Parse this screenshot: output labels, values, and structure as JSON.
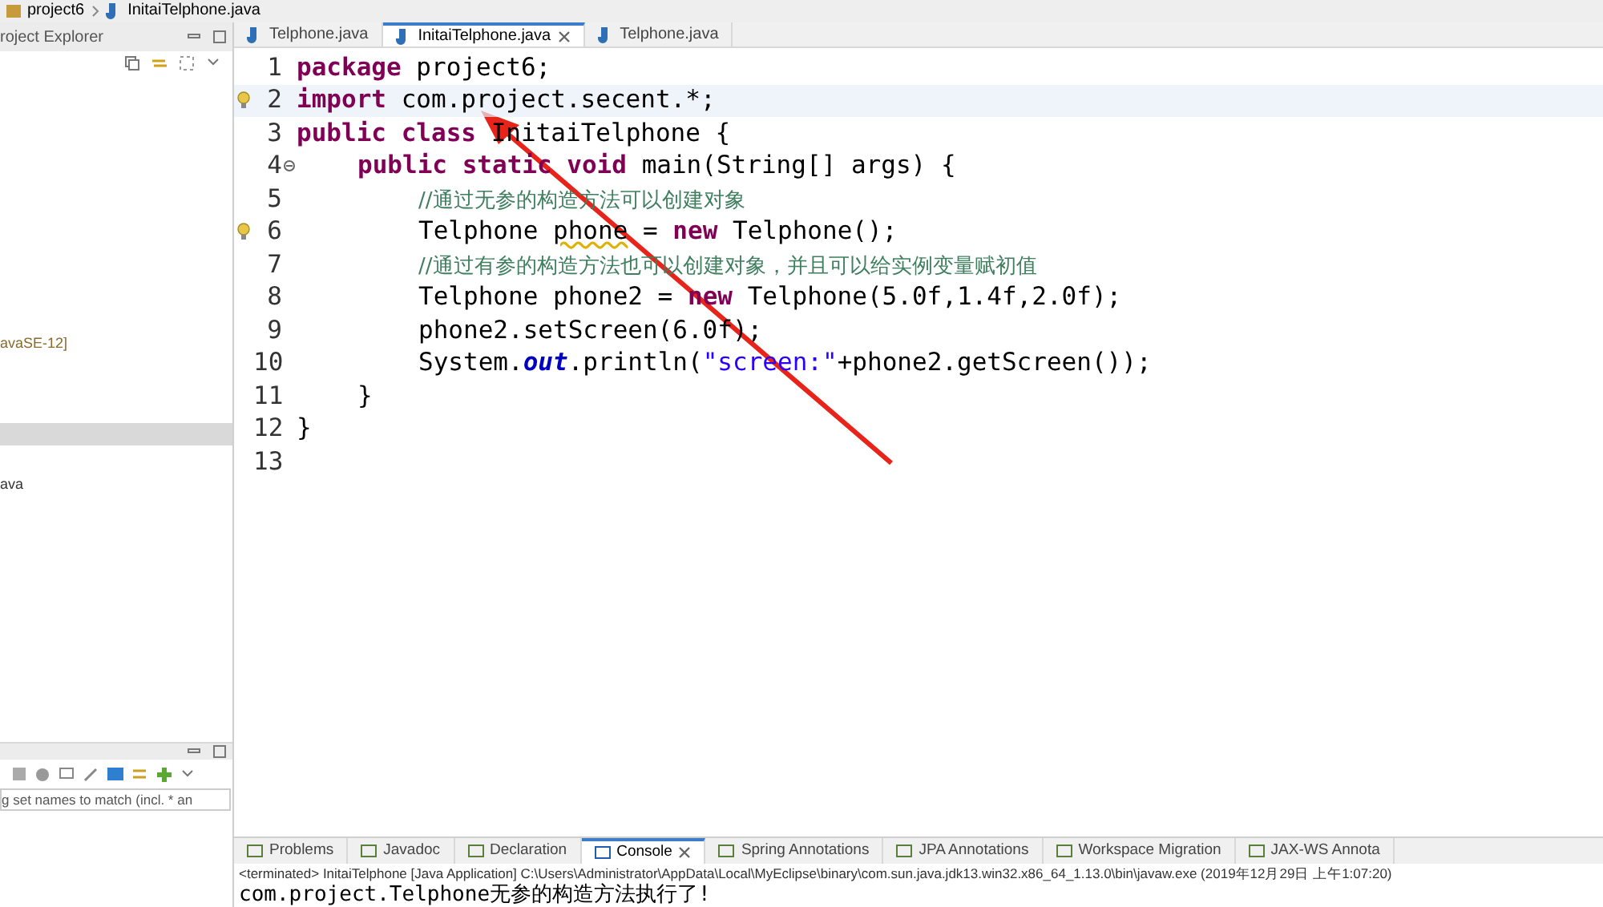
{
  "breadcrumb": [
    "project6",
    "InitaiTelphone.java"
  ],
  "explorer": {
    "title": "roject Explorer",
    "tree_items": [
      "avaSE-12]"
    ],
    "outline_items": [
      "ava"
    ]
  },
  "filter": {
    "placeholder": "g set names to match (incl. * an"
  },
  "editor_tabs": [
    {
      "label": "Telphone.java",
      "selected": false,
      "closable": false
    },
    {
      "label": "InitaiTelphone.java",
      "selected": true,
      "closable": true
    },
    {
      "label": "Telphone.java",
      "selected": false,
      "closable": false
    }
  ],
  "code_lines": [
    {
      "number": "1",
      "kind": "top",
      "current": false,
      "bulb": false,
      "fold": false,
      "tokens": [
        {
          "kind": "keyword",
          "text": "package "
        },
        {
          "kind": "plain",
          "text": "project6;"
        }
      ]
    },
    {
      "number": "2",
      "kind": "top",
      "current": true,
      "bulb": true,
      "fold": false,
      "tokens": [
        {
          "kind": "keyword",
          "text": "import "
        },
        {
          "kind": "plain",
          "text": "com.project.secent.*;"
        }
      ]
    },
    {
      "number": "3",
      "kind": "top",
      "current": false,
      "bulb": false,
      "fold": false,
      "tokens": [
        {
          "kind": "keyword",
          "text": "public class "
        },
        {
          "kind": "plain",
          "text": "InitaiTelphone {"
        }
      ]
    },
    {
      "number": "4",
      "kind": "member",
      "current": false,
      "bulb": false,
      "fold": true,
      "tokens": [
        {
          "kind": "keyword",
          "text": "public static void "
        },
        {
          "kind": "plain",
          "text": "main(String[] args) {"
        }
      ]
    },
    {
      "number": "5",
      "kind": "body",
      "current": false,
      "bulb": false,
      "fold": false,
      "tokens": [
        {
          "kind": "comment",
          "text": "//通过无参的构造方法可以创建对象"
        }
      ]
    },
    {
      "number": "6",
      "kind": "body",
      "current": false,
      "bulb": true,
      "fold": false,
      "tokens": [
        {
          "kind": "plain",
          "text": "Telphone "
        },
        {
          "kind": "warning",
          "text": "phone"
        },
        {
          "kind": "plain",
          "text": " = "
        },
        {
          "kind": "keyword",
          "text": "new "
        },
        {
          "kind": "plain",
          "text": "Telphone();"
        }
      ]
    },
    {
      "number": "7",
      "kind": "body",
      "current": false,
      "bulb": false,
      "fold": false,
      "tokens": [
        {
          "kind": "comment",
          "text": "//通过有参的构造方法也可以创建对象，并且可以给实例变量赋初值"
        }
      ]
    },
    {
      "number": "8",
      "kind": "body",
      "current": false,
      "bulb": false,
      "fold": false,
      "tokens": [
        {
          "kind": "plain",
          "text": "Telphone phone2 = "
        },
        {
          "kind": "keyword",
          "text": "new "
        },
        {
          "kind": "plain",
          "text": "Telphone(5.0f,1.4f,2.0f);"
        }
      ]
    },
    {
      "number": "9",
      "kind": "body",
      "current": false,
      "bulb": false,
      "fold": false,
      "tokens": [
        {
          "kind": "plain",
          "text": "phone2.setScreen(6.0f);"
        }
      ]
    },
    {
      "number": "10",
      "kind": "body",
      "current": false,
      "bulb": false,
      "fold": false,
      "tokens": [
        {
          "kind": "plain",
          "text": "System."
        },
        {
          "kind": "field",
          "text": "out"
        },
        {
          "kind": "plain",
          "text": ".println("
        },
        {
          "kind": "string",
          "text": "\"screen:\""
        },
        {
          "kind": "plain",
          "text": "+phone2.getScreen());"
        }
      ]
    },
    {
      "number": "11",
      "kind": "member",
      "current": false,
      "bulb": false,
      "fold": false,
      "tokens": [
        {
          "kind": "plain",
          "text": "}"
        }
      ]
    },
    {
      "number": "12",
      "kind": "top",
      "current": false,
      "bulb": false,
      "fold": false,
      "tokens": [
        {
          "kind": "plain",
          "text": "}"
        }
      ]
    },
    {
      "number": "13",
      "current": false,
      "bulb": false,
      "fold": false
    }
  ],
  "console_tabs": [
    {
      "label": "Problems",
      "selected": false,
      "closable": false
    },
    {
      "label": "Javadoc",
      "selected": false,
      "closable": false
    },
    {
      "label": "Declaration",
      "selected": false,
      "closable": false
    },
    {
      "label": "Console",
      "selected": true,
      "closable": true
    },
    {
      "label": "Spring Annotations",
      "selected": false,
      "closable": false
    },
    {
      "label": "JPA Annotations",
      "selected": false,
      "closable": false
    },
    {
      "label": "Workspace Migration",
      "selected": false,
      "closable": false
    },
    {
      "label": "JAX-WS Annota",
      "selected": false,
      "closable": false
    }
  ],
  "console_status": "<terminated> InitaiTelphone [Java Application] C:\\Users\\Administrator\\AppData\\Local\\MyEclipse\\binary\\com.sun.java.jdk13.win32.x86_64_1.13.0\\bin\\javaw.exe (2019年12月29日 上午1:07:20)",
  "console_output": "com.project.Telphone无参的构造方法执行了!"
}
